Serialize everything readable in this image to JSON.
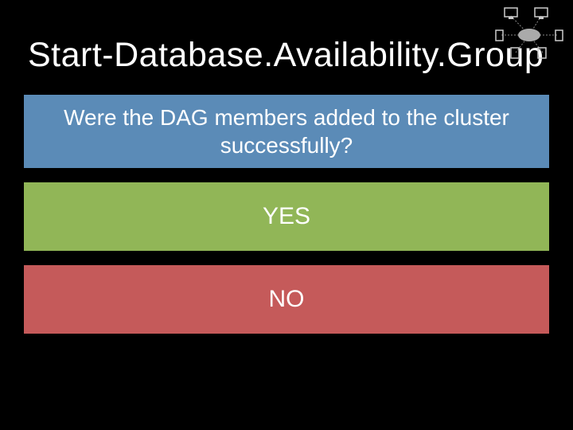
{
  "title": "Start-Database.Availability.Group",
  "question": "Were the DAG members added to the cluster successfully?",
  "yes_label": "YES",
  "no_label": "NO",
  "colors": {
    "background": "#000000",
    "question_panel": "#5b8bb7",
    "yes_panel": "#91b657",
    "no_panel": "#c55a5a",
    "text": "#ffffff"
  }
}
